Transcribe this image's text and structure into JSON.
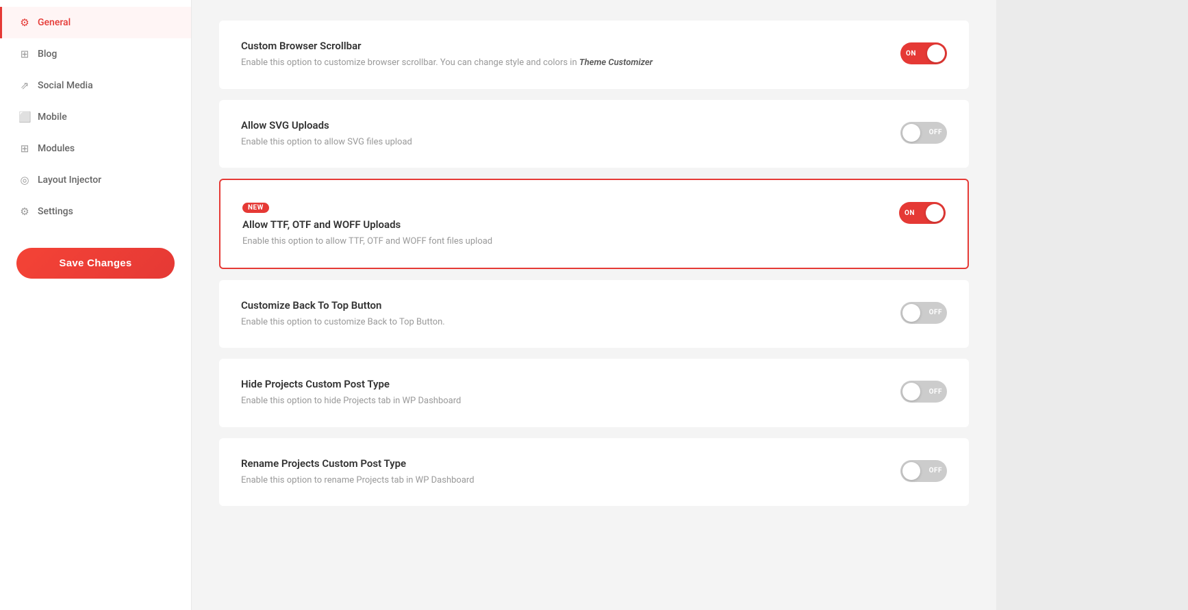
{
  "sidebar": {
    "items": [
      {
        "id": "general",
        "label": "General",
        "icon": "⚙",
        "active": true
      },
      {
        "id": "blog",
        "label": "Blog",
        "icon": "▦",
        "active": false
      },
      {
        "id": "social-media",
        "label": "Social Media",
        "icon": "⇗",
        "active": false
      },
      {
        "id": "mobile",
        "label": "Mobile",
        "icon": "□",
        "active": false
      },
      {
        "id": "modules",
        "label": "Modules",
        "icon": "▦",
        "active": false
      },
      {
        "id": "layout-injector",
        "label": "Layout Injector",
        "icon": "◎",
        "active": false
      },
      {
        "id": "settings",
        "label": "Settings",
        "icon": "⚙",
        "active": false
      }
    ],
    "save_button_label": "Save Changes"
  },
  "settings": [
    {
      "id": "custom-browser-scrollbar",
      "title": "Custom Browser Scrollbar",
      "description": "Enable this option to customize browser scrollbar. You can change style and colors in ",
      "description_link": "Theme Customizer",
      "toggle_state": "on",
      "highlighted": false,
      "badge": null
    },
    {
      "id": "allow-svg-uploads",
      "title": "Allow SVG Uploads",
      "description": "Enable this option to allow SVG files upload",
      "toggle_state": "off",
      "highlighted": false,
      "badge": null
    },
    {
      "id": "allow-ttf-otf-woff",
      "title": "Allow TTF, OTF and WOFF Uploads",
      "description": "Enable this option to allow TTF, OTF and WOFF font files upload",
      "toggle_state": "on",
      "highlighted": true,
      "badge": "NEW"
    },
    {
      "id": "customize-back-to-top",
      "title": "Customize Back To Top Button",
      "description": "Enable this option to customize Back to Top Button.",
      "toggle_state": "off",
      "highlighted": false,
      "badge": null
    },
    {
      "id": "hide-projects-post-type",
      "title": "Hide Projects Custom Post Type",
      "description": "Enable this option to hide Projects tab in WP Dashboard",
      "toggle_state": "off",
      "highlighted": false,
      "badge": null
    },
    {
      "id": "rename-projects-post-type",
      "title": "Rename Projects Custom Post Type",
      "description": "Enable this option to rename Projects tab in WP Dashboard",
      "toggle_state": "off",
      "highlighted": false,
      "badge": null
    }
  ],
  "icons": {
    "gear": "⚙",
    "blog": "▦",
    "social": "⇗",
    "mobile": "□",
    "modules": "▦",
    "layout": "◎",
    "settings": "⚙"
  },
  "colors": {
    "accent": "#e53935",
    "sidebar_active_border": "#e53935",
    "toggle_on": "#e53935",
    "toggle_off": "#cccccc"
  }
}
